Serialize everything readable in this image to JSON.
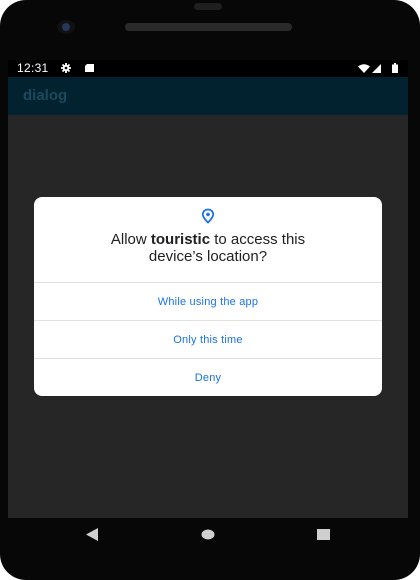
{
  "status_bar": {
    "time": "12:31",
    "icons": [
      "gear-icon",
      "sd-card-icon",
      "wifi-icon",
      "signal-icon",
      "battery-icon"
    ]
  },
  "app_bar": {
    "title": "dialog"
  },
  "permission_dialog": {
    "icon": "location-pin-icon",
    "title_prefix": "Allow ",
    "app_name": "touristic",
    "title_suffix": " to access this",
    "title_line2": "device’s location?",
    "options": {
      "while_using": "While using the app",
      "only_this_time": "Only this time",
      "deny": "Deny"
    }
  },
  "nav_bar": {
    "icons": [
      "back-icon",
      "home-icon",
      "recents-icon"
    ]
  },
  "colors": {
    "accent": "#1a73e8",
    "app_bar": "#02222f",
    "app_title": "#1b4a5c",
    "scrim": "#262626"
  }
}
